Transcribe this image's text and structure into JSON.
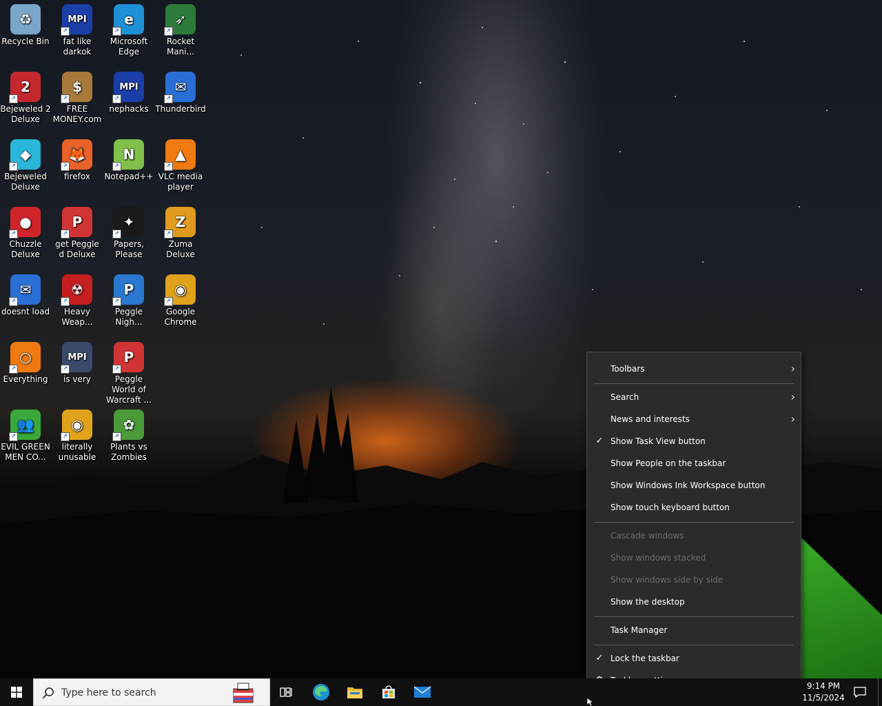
{
  "desktop": {
    "icons": [
      {
        "label": "Recycle Bin",
        "icon": "recycle-bin-icon",
        "color": "#7aa6c9",
        "glyph": "♻"
      },
      {
        "label": "fat like darkok",
        "icon": "mpi-shortcut-icon",
        "color": "#1b3fa8",
        "glyph": "MPI"
      },
      {
        "label": "Microsoft Edge",
        "icon": "edge-icon",
        "color": "#1e90d6",
        "glyph": "e"
      },
      {
        "label": "Rocket Mani...",
        "icon": "rocket-icon",
        "color": "#2d7a3a",
        "glyph": "➶"
      },
      {
        "label": "Bejeweled 2 Deluxe",
        "icon": "bejeweled2-icon",
        "color": "#c4282e",
        "glyph": "2"
      },
      {
        "label": "FREE MONEY.com",
        "icon": "money-bag-icon",
        "color": "#a9793b",
        "glyph": "$"
      },
      {
        "label": "nephacks",
        "icon": "mpi-shortcut-icon",
        "color": "#1b3fa8",
        "glyph": "MPI"
      },
      {
        "label": "Thunderbird",
        "icon": "thunderbird-icon",
        "color": "#2a6fd6",
        "glyph": "✉"
      },
      {
        "label": "Bejeweled Deluxe",
        "icon": "diamond-icon",
        "color": "#29b6d9",
        "glyph": "◆"
      },
      {
        "label": "firefox",
        "icon": "firefox-icon",
        "color": "#e8622a",
        "glyph": "🦊"
      },
      {
        "label": "Notepad++",
        "icon": "notepad-plus-icon",
        "color": "#7fbf4a",
        "glyph": "N"
      },
      {
        "label": "VLC media player",
        "icon": "vlc-cone-icon",
        "color": "#f07a0f",
        "glyph": "▲"
      },
      {
        "label": "Chuzzle Deluxe",
        "icon": "chuzzle-icon",
        "color": "#d0242a",
        "glyph": "●"
      },
      {
        "label": "get Peggle d Deluxe",
        "icon": "peggle-icon",
        "color": "#d13434",
        "glyph": "P"
      },
      {
        "label": "Papers, Please",
        "icon": "papers-please-icon",
        "color": "#1a1a1a",
        "glyph": "✦"
      },
      {
        "label": "Zuma Deluxe",
        "icon": "zuma-icon",
        "color": "#e09a1d",
        "glyph": "Z"
      },
      {
        "label": "doesnt load",
        "icon": "thunderbird-icon",
        "color": "#2a6fd6",
        "glyph": "✉"
      },
      {
        "label": "Heavy Weap...",
        "icon": "radiation-icon",
        "color": "#c41e1e",
        "glyph": "☢"
      },
      {
        "label": "Peggle Nigh...",
        "icon": "peggle-icon",
        "color": "#2a78d0",
        "glyph": "P"
      },
      {
        "label": "Google Chrome",
        "icon": "chrome-icon",
        "color": "#e0a21b",
        "glyph": "◉"
      },
      {
        "label": "Everything",
        "icon": "magnifier-icon",
        "color": "#f07a0f",
        "glyph": "○"
      },
      {
        "label": "is very",
        "icon": "mpi-shield-icon",
        "color": "#3a4a6a",
        "glyph": "MPI"
      },
      {
        "label": "Peggle World of Warcraft ...",
        "icon": "peggle-icon",
        "color": "#d13434",
        "glyph": "P"
      },
      {
        "label": "",
        "icon": "empty-slot",
        "color": "#000000",
        "glyph": ""
      },
      {
        "label": "EVIL GREEN MEN CO...",
        "icon": "green-men-icon",
        "color": "#3aa83a",
        "glyph": "👥"
      },
      {
        "label": "literally unusable",
        "icon": "chrome-icon",
        "color": "#e0a21b",
        "glyph": "◉"
      },
      {
        "label": "Plants vs Zombies",
        "icon": "plants-icon",
        "color": "#4a9a3a",
        "glyph": "✿"
      }
    ]
  },
  "context_menu": {
    "toolbars": "Toolbars",
    "search": "Search",
    "news": "News and interests",
    "task_view": "Show Task View button",
    "people": "Show People on the taskbar",
    "ink": "Show Windows Ink Workspace button",
    "touch_keyboard": "Show touch keyboard button",
    "cascade": "Cascade windows",
    "stacked": "Show windows stacked",
    "side_by_side": "Show windows side by side",
    "show_desktop": "Show the desktop",
    "task_manager": "Task Manager",
    "lock": "Lock the taskbar",
    "settings": "Taskbar settings"
  },
  "taskbar": {
    "search_placeholder": "Type here to search",
    "time": "9:14 PM",
    "date": "11/5/2024",
    "pinned": [
      "task-view-icon",
      "edge-icon",
      "file-explorer-icon",
      "store-icon",
      "mail-icon"
    ]
  }
}
